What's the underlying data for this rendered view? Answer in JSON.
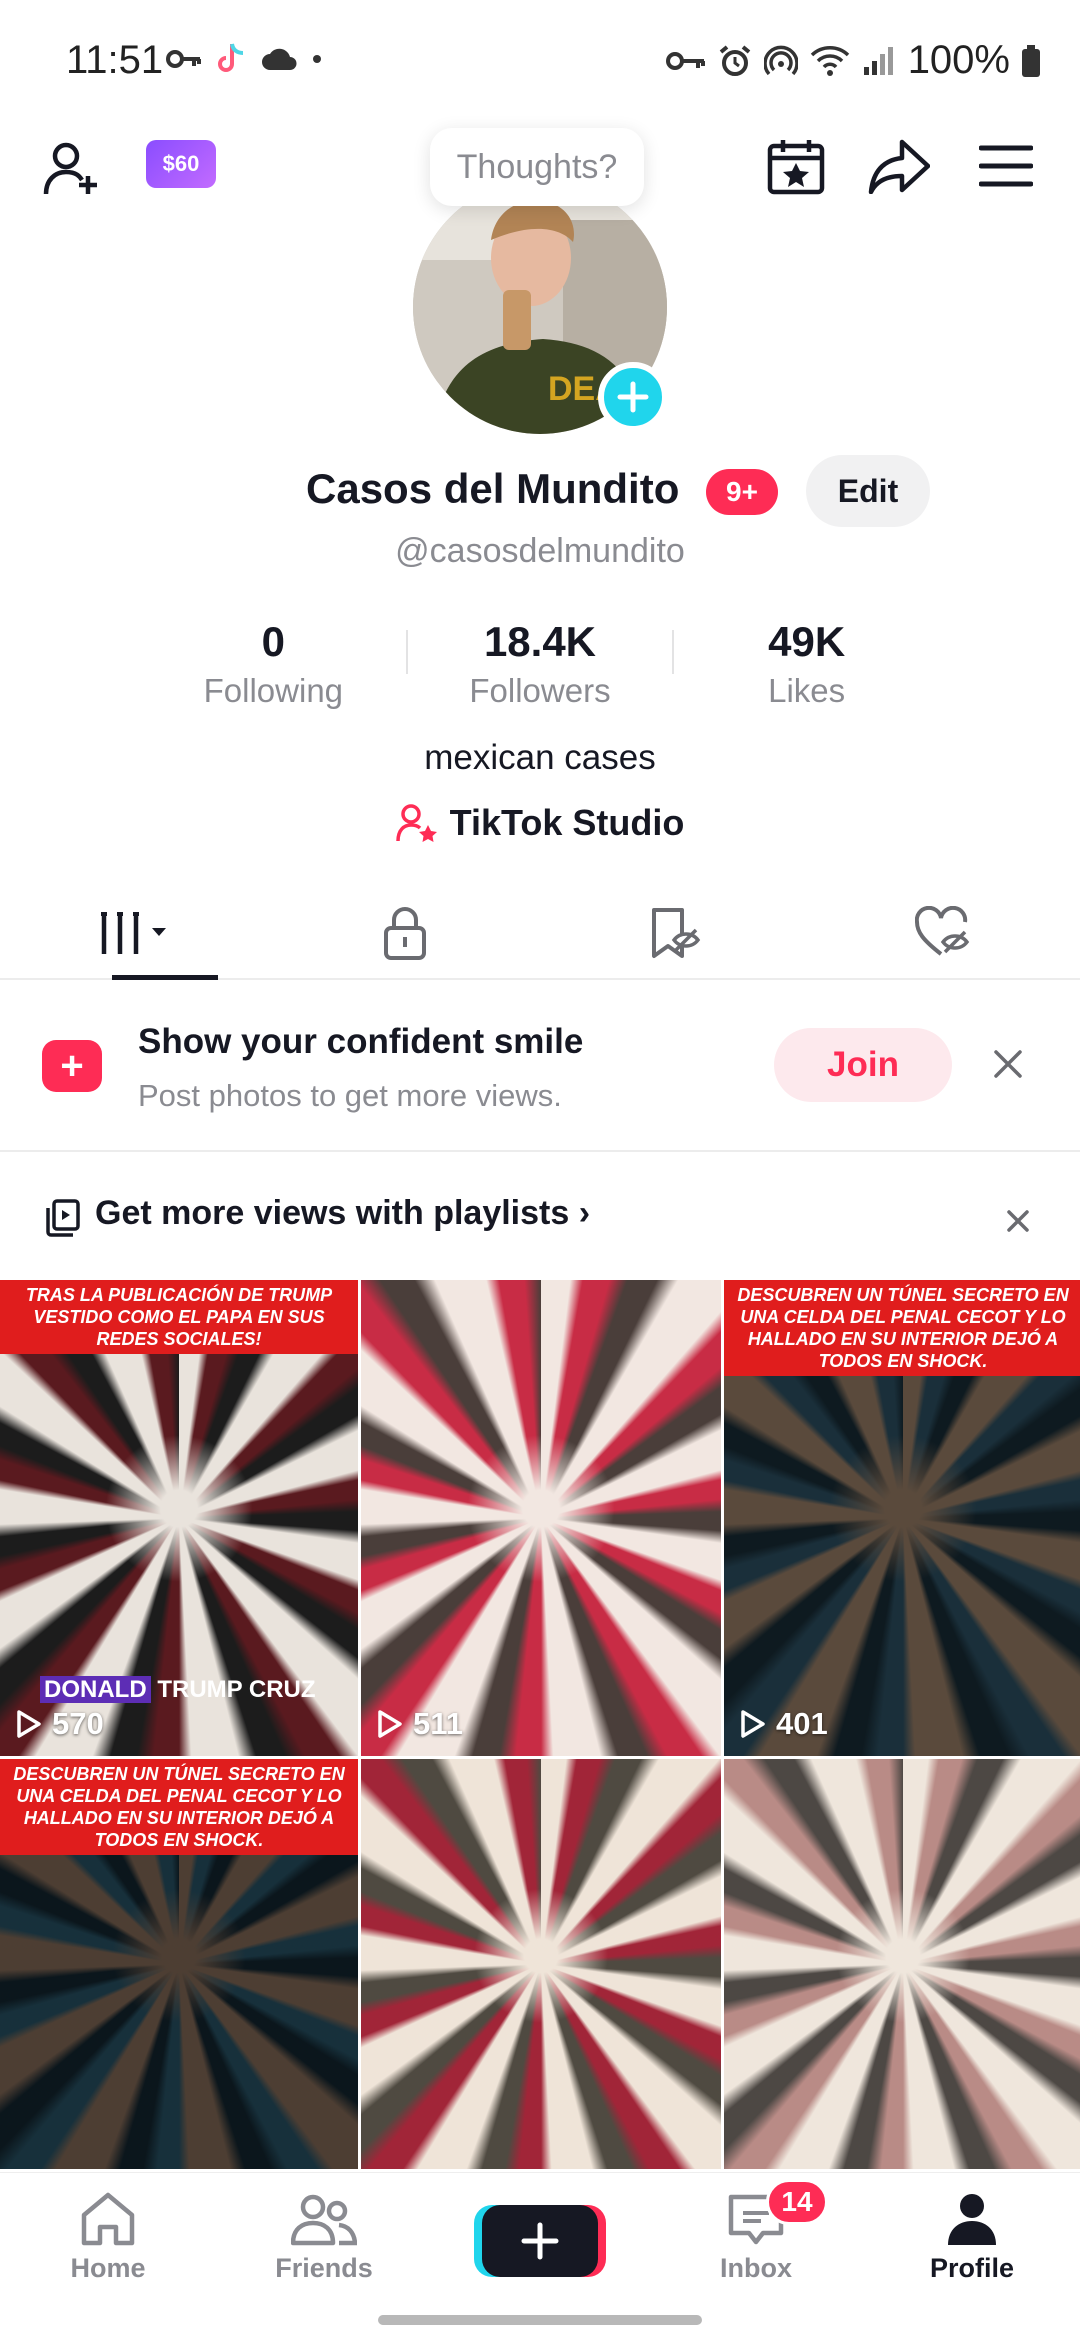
{
  "status_bar": {
    "time": "11:51",
    "battery": "100%"
  },
  "top_bar": {
    "coin_label": "$60",
    "thoughts_placeholder": "Thoughts?"
  },
  "profile": {
    "name": "Casos del Mundito",
    "notification_count": "9+",
    "edit_label": "Edit",
    "username": "@casosdelmundito",
    "stats": [
      {
        "value": "0",
        "label": "Following"
      },
      {
        "value": "18.4K",
        "label": "Followers"
      },
      {
        "value": "49K",
        "label": "Likes"
      }
    ],
    "bio": "mexican cases",
    "studio_link": "TikTok Studio"
  },
  "tabs": [
    {
      "icon": "grid-icon",
      "active": true
    },
    {
      "icon": "lock-icon",
      "active": false
    },
    {
      "icon": "hidden-bookmark-icon",
      "active": false
    },
    {
      "icon": "hidden-heart-icon",
      "active": false
    }
  ],
  "promo": {
    "title": "Show your confident smile",
    "subtitle": "Post photos to get more views.",
    "join_label": "Join"
  },
  "playlist_bar": {
    "text": "Get more views with playlists"
  },
  "videos": [
    {
      "banner": "TRAS LA PUBLICACIÓN DE TRUMP VESTIDO COMO EL PAPA EN SUS REDES SOCIALES!",
      "views": "570",
      "caption_hl": "DONALD",
      "caption": "TRUMP CRUZ",
      "colors": [
        "#e9e3dc",
        "#5a1a1f",
        "#1c1c1c"
      ]
    },
    {
      "banner": "",
      "views": "511",
      "caption_hl": "",
      "caption": "",
      "colors": [
        "#f2e7e1",
        "#c82c45",
        "#4a3e3a"
      ]
    },
    {
      "banner": "DESCUBREN UN TÚNEL SECRETO EN UNA CELDA DEL PENAL CECOT Y LO HALLADO EN SU INTERIOR DEJÓ A TODOS EN SHOCK.",
      "views": "401",
      "caption_hl": "",
      "caption": "",
      "colors": [
        "#5a4a3c",
        "#1a2f3a",
        "#0e1a20"
      ]
    },
    {
      "banner": "DESCUBREN UN TÚNEL SECRETO EN UNA CELDA DEL PENAL CECOT Y LO HALLADO EN SU INTERIOR DEJÓ A TODOS EN SHOCK.",
      "views": "",
      "caption_hl": "",
      "caption": "",
      "colors": [
        "#4d3e33",
        "#17303b",
        "#0b161c"
      ]
    },
    {
      "banner": "",
      "views": "",
      "caption_hl": "",
      "caption": "",
      "colors": [
        "#efe4d8",
        "#a12538",
        "#4f4a41"
      ]
    },
    {
      "banner": "",
      "views": "",
      "caption_hl": "",
      "caption": "",
      "colors": [
        "#efe6dc",
        "#b98b86",
        "#4d4844"
      ]
    }
  ],
  "bottom_nav": [
    {
      "label": "Home",
      "icon": "home-icon"
    },
    {
      "label": "Friends",
      "icon": "friends-icon"
    },
    {
      "label": "",
      "icon": "plus-icon"
    },
    {
      "label": "Inbox",
      "icon": "inbox-icon",
      "badge": "14"
    },
    {
      "label": "Profile",
      "icon": "profile-icon",
      "active": true
    }
  ]
}
